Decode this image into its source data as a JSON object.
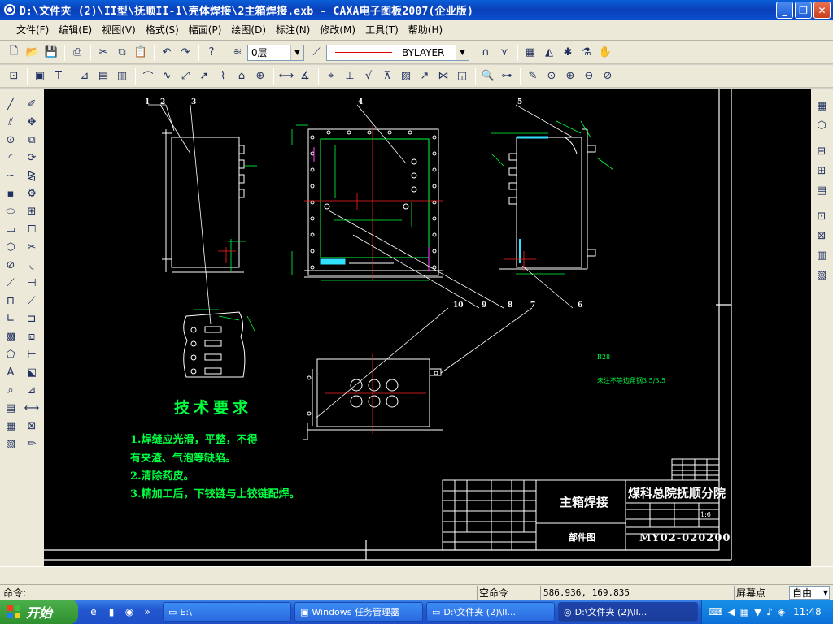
{
  "window": {
    "title": "D:\\文件夹 (2)\\II型\\抚顺II-1\\壳体焊接\\2主箱焊接.exb - CAXA电子图板2007(企业版)",
    "buttons": [
      "_",
      "❐",
      "✕"
    ]
  },
  "menu": [
    "文件(F)",
    "编辑(E)",
    "视图(V)",
    "格式(S)",
    "幅面(P)",
    "绘图(D)",
    "标注(N)",
    "修改(M)",
    "工具(T)",
    "帮助(H)"
  ],
  "toolbar": {
    "layer_value": "0层",
    "linetype_value": "BYLAYER"
  },
  "drawing": {
    "leader_numbers": [
      "1",
      "2",
      "3",
      "4",
      "5",
      "6",
      "7",
      "8",
      "9",
      "10"
    ],
    "tech_title": "技术要求",
    "tech_notes": [
      "1.焊缝应光滑，平整，不得",
      "有夹渣、气泡等缺陷。",
      "2.清除药皮。",
      "3.精加工后，下铰链与上铰链配焊。"
    ],
    "note_small_1": "B28",
    "note_small_2": "未注不等边角钢3.5/3.5",
    "title_block": {
      "part_name": "主箱焊接",
      "drawing_type": "部件图",
      "company": "煤科总院抚顺分院",
      "drawing_number": "MY02-020200",
      "scale": "1:6"
    }
  },
  "status": {
    "command_prompt": "命令:",
    "idle_command": "空命令",
    "coordinates": "586.936, 169.835",
    "snap_label": "屏幕点",
    "snap_mode": "自由"
  },
  "taskbar": {
    "start_label": "开始",
    "tasks": [
      "E:\\",
      "Windows 任务管理器",
      "D:\\文件夹 (2)\\II...",
      "D:\\文件夹 (2)\\II..."
    ],
    "clock": "11:48"
  },
  "colors": {
    "canvas": "#000000",
    "cad_green": "#00ff40",
    "cad_red": "#ff2020",
    "cad_magenta": "#ff40ff",
    "cad_cyan": "#30e0ff"
  }
}
